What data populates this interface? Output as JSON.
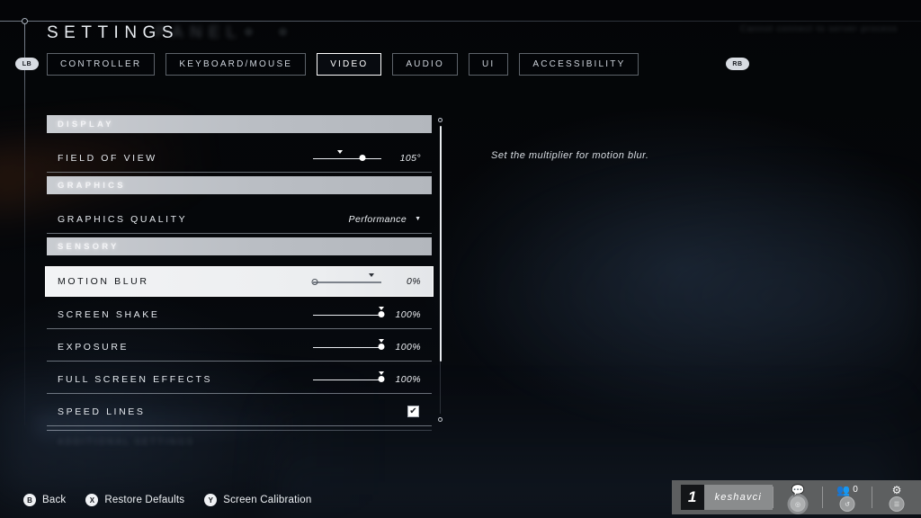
{
  "header": {
    "title": "SETTINGS",
    "title_ghost": "PANEL",
    "corner_ghost": "Cannot connect to server process",
    "bumper_left": "LB",
    "bumper_right": "RB"
  },
  "tabs": [
    {
      "label": "CONTROLLER",
      "active": false
    },
    {
      "label": "KEYBOARD/MOUSE",
      "active": false
    },
    {
      "label": "VIDEO",
      "active": true
    },
    {
      "label": "AUDIO",
      "active": false
    },
    {
      "label": "UI",
      "active": false
    },
    {
      "label": "ACCESSIBILITY",
      "active": false
    }
  ],
  "settings": {
    "sections": [
      {
        "type": "header",
        "label": "DISPLAY"
      },
      {
        "type": "slider",
        "label": "FIELD OF VIEW",
        "value": "105°",
        "fill": 72,
        "marker": 40,
        "selected": false
      },
      {
        "type": "header",
        "label": "GRAPHICS"
      },
      {
        "type": "dropdown",
        "label": "GRAPHICS QUALITY",
        "value": "Performance",
        "caret": "▼",
        "selected": false
      },
      {
        "type": "header",
        "label": "SENSORY"
      },
      {
        "type": "slider",
        "label": "MOTION BLUR",
        "value": "0%",
        "fill": 2,
        "marker": 85,
        "selected": true
      },
      {
        "type": "slider",
        "label": "SCREEN SHAKE",
        "value": "100%",
        "fill": 100,
        "marker": 100,
        "selected": false
      },
      {
        "type": "slider",
        "label": "EXPOSURE",
        "value": "100%",
        "fill": 100,
        "marker": 100,
        "selected": false
      },
      {
        "type": "slider",
        "label": "FULL SCREEN EFFECTS",
        "value": "100%",
        "fill": 100,
        "marker": 100,
        "selected": false
      },
      {
        "type": "checkbox",
        "label": "SPEED LINES",
        "checked": true,
        "check_glyph": "✔",
        "selected": false
      },
      {
        "type": "ghost",
        "label": "ADDITIONAL SETTINGS"
      }
    ]
  },
  "description": "Set the multiplier for motion blur.",
  "prompts": [
    {
      "glyph": "B",
      "label": "Back"
    },
    {
      "glyph": "X",
      "label": "Restore Defaults"
    },
    {
      "glyph": "Y",
      "label": "Screen Calibration"
    }
  ],
  "hud": {
    "level": "1",
    "username": "keshavci",
    "chat_icon": "💬",
    "chat_key": "◎",
    "party_icon": "👥",
    "party_count": "0",
    "party_key": "↺",
    "settings_icon": "⚙",
    "settings_key": "☰"
  },
  "colors": {
    "accent": "#ffffff",
    "panel_header": "#c2c6cb",
    "hud_bg": "#5d5f60"
  }
}
